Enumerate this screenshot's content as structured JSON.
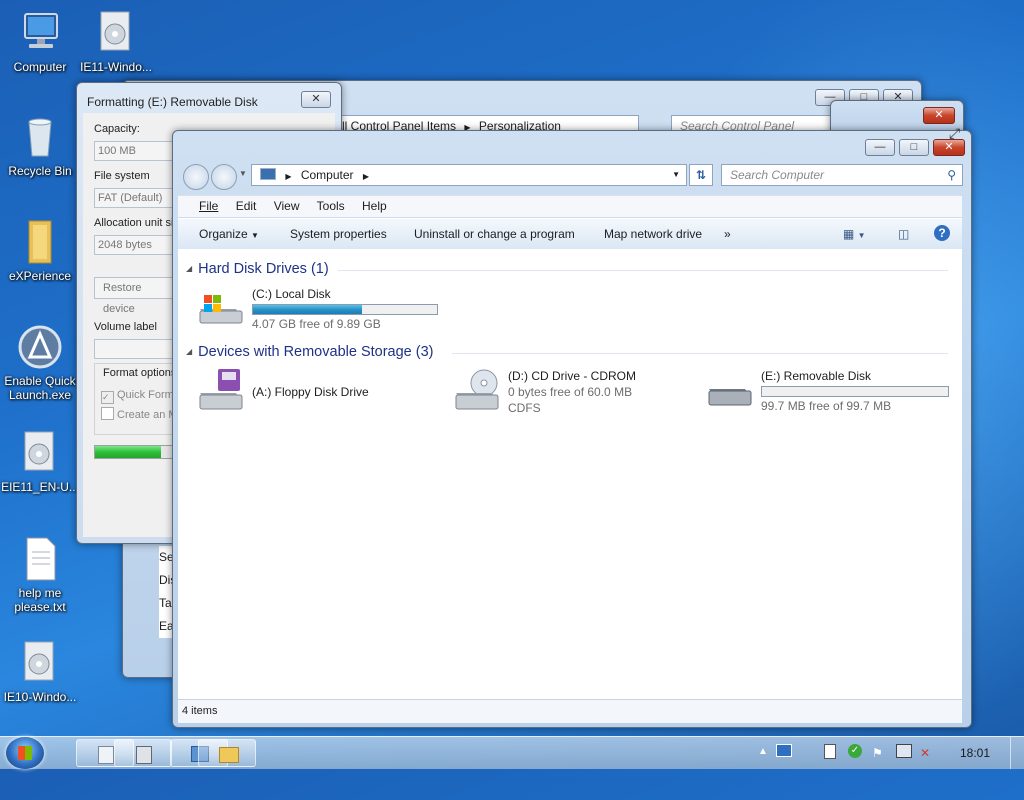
{
  "desktop": {
    "icons": [
      {
        "label": "Computer"
      },
      {
        "label": "IE11-Windo..."
      },
      {
        "label": "Recycle Bin"
      },
      {
        "label": "eXPerience"
      },
      {
        "label": "Enable Quick Launch.exe"
      },
      {
        "label": "EIE11_EN-U..."
      },
      {
        "label": "help me please.txt"
      },
      {
        "label": "IE10-Windo..."
      }
    ]
  },
  "format_dialog": {
    "title": "Formatting (E:) Removable Disk",
    "capacity_label": "Capacity:",
    "capacity_value": "100 MB",
    "filesystem_label": "File system",
    "filesystem_value": "FAT (Default)",
    "alloc_label": "Allocation unit siz",
    "alloc_value": "2048 bytes",
    "restore_button": "Restore device",
    "volume_label": "Volume label",
    "format_options": "Format options",
    "quick_format": "Quick Forma",
    "create_msdos": "Create an M",
    "progress": 0.75
  },
  "control_panel": {
    "breadcrumb": [
      "ll Control Panel Items",
      "Personalization"
    ],
    "search_placeholder": "Search Control Panel",
    "behind_items": [
      "Se",
      "Dis",
      "Ta",
      "Ea"
    ]
  },
  "explorer": {
    "address": "Computer",
    "search_placeholder": "Search Computer",
    "menu": [
      "File",
      "Edit",
      "View",
      "Tools",
      "Help"
    ],
    "toolbar": {
      "organize": "Organize",
      "system_properties": "System properties",
      "uninstall": "Uninstall or change a program",
      "map_drive": "Map network drive",
      "more": "»"
    },
    "groups": {
      "hdd": "Hard Disk Drives (1)",
      "removable": "Devices with Removable Storage (3)"
    },
    "drives": {
      "c": {
        "name": "(C:) Local Disk",
        "sub": "4.07 GB free of 9.89 GB",
        "used_fraction": 0.59
      },
      "a": {
        "name": "(A:) Floppy Disk Drive"
      },
      "d": {
        "name": "(D:) CD Drive - CDROM",
        "sub": "0 bytes free of 60.0 MB",
        "sub2": "CDFS"
      },
      "e": {
        "name": "(E:) Removable Disk",
        "sub": "99.7 MB free of 99.7 MB",
        "used_fraction": 0.0
      }
    },
    "status": "4 items"
  },
  "taskbar": {
    "clock": "18:01"
  },
  "colors": {
    "accent": "#1e3287",
    "close": "#c8442b",
    "progress_green": "#2fbf3a"
  }
}
